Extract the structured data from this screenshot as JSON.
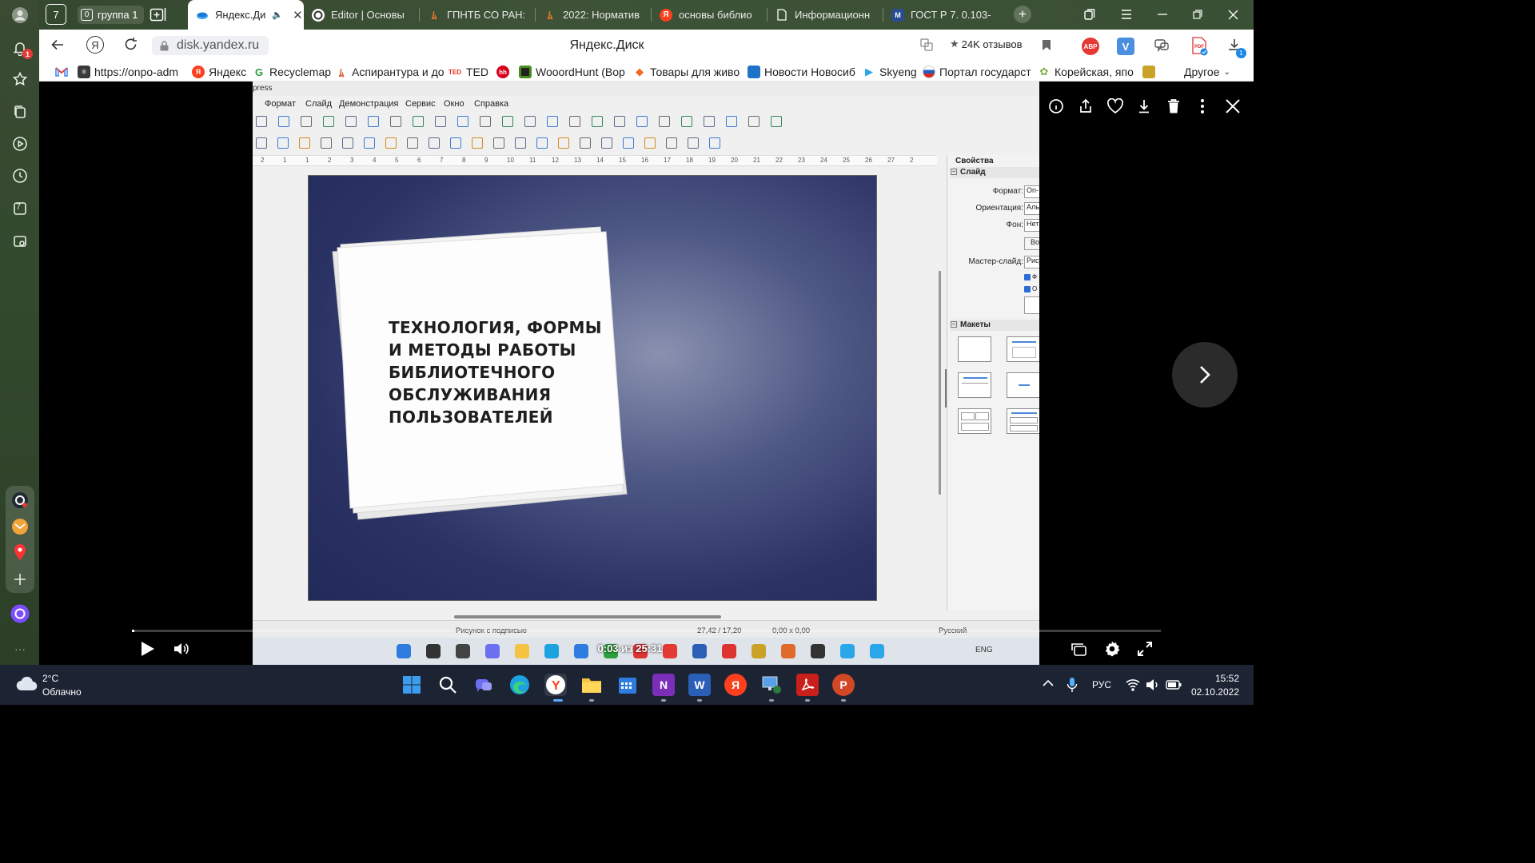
{
  "sidebar": {
    "notification_count": "1",
    "calendar_day": "7"
  },
  "tabs": {
    "counter": "7",
    "group": {
      "count": "0",
      "label": "группа 1"
    },
    "items": [
      {
        "label": "Яндекс.Ди",
        "favicon": "yandex-disk-icon",
        "active": true
      },
      {
        "label": "Editor | Основы",
        "favicon": "editor-icon"
      },
      {
        "label": "ГПНТБ СО РАН:",
        "favicon": "gpntb-icon"
      },
      {
        "label": "2022: Норматив",
        "favicon": "gpntb-icon"
      },
      {
        "label": "основы библио",
        "favicon": "yandex-icon"
      },
      {
        "label": "Информационн",
        "favicon": "document-icon"
      },
      {
        "label": "ГОСТ Р 7. 0.103-",
        "favicon": "gost-icon"
      }
    ]
  },
  "addressbar": {
    "url": "disk.yandex.ru",
    "page_title": "Яндекс.Диск",
    "reviews": "24K отзывов",
    "abp_label": "ABP",
    "downloads_badge": "1"
  },
  "bookmarks": {
    "items": [
      {
        "label": "https://onpo-adm",
        "color": "#3a3a3a",
        "glyph": "⚛"
      },
      {
        "label": "Яндекс",
        "color": "#fc3f1d",
        "glyph": "Я"
      },
      {
        "label": "Recyclemap",
        "color": "#2e9e3e",
        "glyph": "G"
      },
      {
        "label": "Аспирантура и до",
        "color": "#d9542a",
        "glyph": "ﾑ"
      },
      {
        "label": "TED",
        "color": "#e62b1e",
        "glyph": "TED"
      },
      {
        "label": "",
        "color": "#d6001c",
        "glyph": "hh"
      },
      {
        "label": "WooordHunt (Вор",
        "color": "#4b8e1e",
        "glyph": "W"
      },
      {
        "label": "Товары для живо",
        "color": "#f26a21",
        "glyph": "🦊"
      },
      {
        "label": "Новости Новосиб",
        "color": "#1e72c8",
        "glyph": "▦"
      },
      {
        "label": "Skyeng",
        "color": "#2aa7e8",
        "glyph": "▶"
      },
      {
        "label": "Портал государст",
        "color": "#1f5fbf",
        "glyph": "●"
      },
      {
        "label": "Корейская, япо",
        "color": "#7bb142",
        "glyph": "✿"
      }
    ],
    "other_label": "Другое"
  },
  "libreoffice": {
    "app_fragment": "press",
    "menu": [
      "Формат",
      "Слайд",
      "Демонстрация",
      "Сервис",
      "Окно",
      "Справка"
    ],
    "ruler": [
      "2",
      "1",
      "1",
      "2",
      "3",
      "4",
      "5",
      "6",
      "7",
      "8",
      "9",
      "10",
      "11",
      "12",
      "13",
      "14",
      "15",
      "16",
      "17",
      "18",
      "19",
      "20",
      "21",
      "22",
      "23",
      "24",
      "25",
      "26",
      "27",
      "2"
    ],
    "properties": {
      "title": "Свойства",
      "section_slide": "Слайд",
      "format_label": "Формат:",
      "format_value": "On-",
      "orientation_label": "Ориентация:",
      "orientation_value": "Аль",
      "background_label": "Фон:",
      "background_value": "Нет",
      "background_btn": "Во",
      "master_label": "Мастер-слайд:",
      "master_value": "Рису",
      "check1": "Ф",
      "check2": "О",
      "section_layouts": "Макеты"
    },
    "slide_title": "ТЕХНОЛОГИЯ, ФОРМЫ И МЕТОДЫ РАБОТЫ БИБЛИОТЕЧНОГО ОБСЛУЖИВАНИЯ ПОЛЬЗОВАТЕЛЕЙ",
    "status": {
      "object": "Рисунок с подписью",
      "position": "27,42 / 17,20",
      "size": "0,00 x 0,00",
      "language": "Русский"
    },
    "inner_taskbar_lang": "ENG"
  },
  "player": {
    "time": "0:03 из 25:31",
    "progress_fraction": 0.002
  },
  "taskbar": {
    "weather_temp": "2°C",
    "weather_desc": "Облачно",
    "language": "РУС",
    "time": "15:52",
    "date": "02.10.2022"
  }
}
